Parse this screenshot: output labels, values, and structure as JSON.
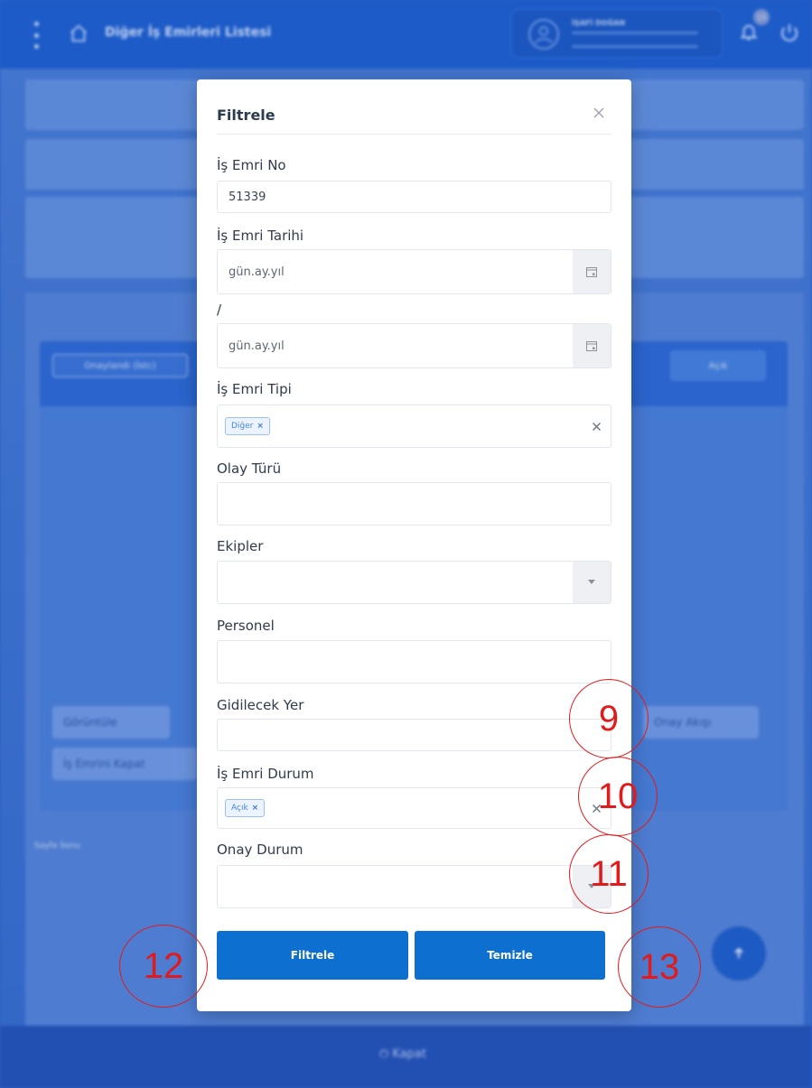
{
  "background": {
    "header": {
      "title": "Diğer İş Emirleri Listesi",
      "user_name": "İŞAFİ DOĞAN",
      "notification_count": "15"
    },
    "footer": {
      "close_label": "Kapat"
    },
    "buttons": {
      "view_label": "Görüntüle",
      "approval_flow_label": "Onay Akışı",
      "close_work_order_label": "İş Emrini Kapat",
      "approval_pill_label": "Onaylandı (İstc)",
      "open_label": "Açık"
    },
    "page_number_label": "Sayfa Sonu",
    "scroll_top_icon": "arrow-up-icon"
  },
  "modal": {
    "title": "Filtrele",
    "fields": {
      "work_order_no": {
        "label": "İş Emri No",
        "value": "51339"
      },
      "work_order_date": {
        "label": "İş Emri Tarihi",
        "placeholder_start": "gün.ay.yıl",
        "separator": "/",
        "placeholder_end": "gün.ay.yıl"
      },
      "work_order_type": {
        "label": "İş Emri Tipi",
        "tag": "Diğer"
      },
      "event_type": {
        "label": "Olay Türü"
      },
      "teams": {
        "label": "Ekipler"
      },
      "personnel": {
        "label": "Personel"
      },
      "destination": {
        "label": "Gidilecek Yer"
      },
      "work_order_status": {
        "label": "İş Emri Durum",
        "tag": "Açık"
      },
      "approval_status": {
        "label": "Onay Durum"
      }
    },
    "buttons": {
      "filter": "Filtrele",
      "clear": "Temizle"
    }
  },
  "annotations": {
    "m9": "9",
    "m10": "10",
    "m11": "11",
    "m12": "12",
    "m13": "13"
  },
  "colors": {
    "primary": "#0d6fd0",
    "header": "#1d60cf",
    "annotation": "#e11b1b",
    "tag_bg": "#eaf3ff"
  }
}
